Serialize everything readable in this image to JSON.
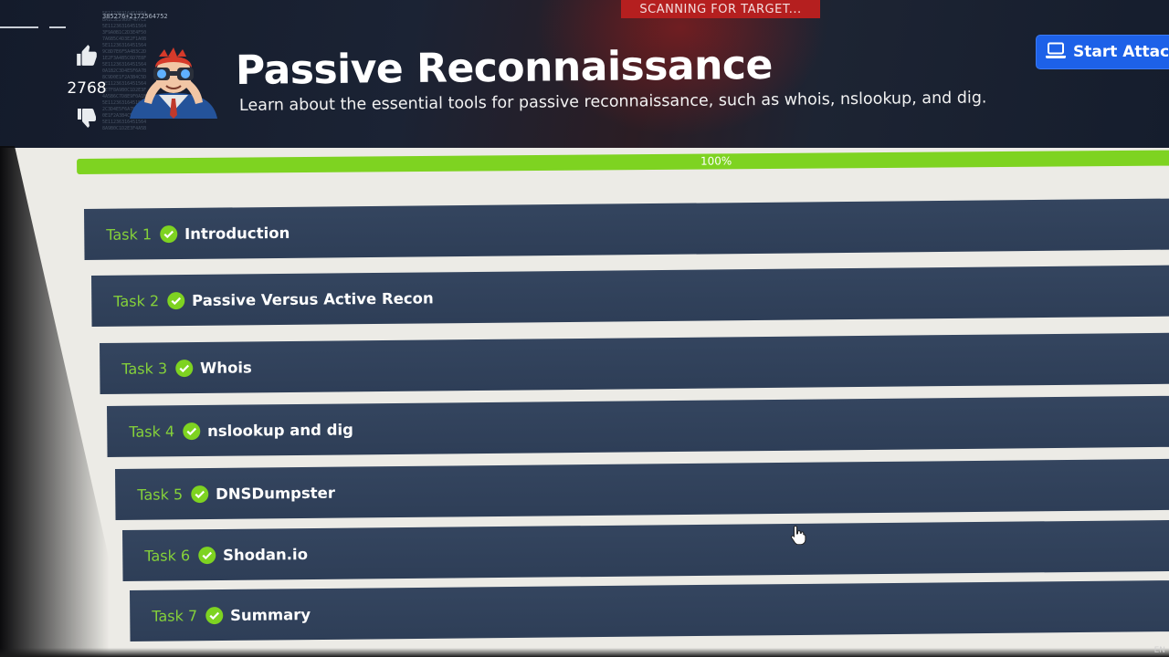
{
  "header": {
    "scanning_text": "SCANNING FOR TARGET...",
    "hex_text": "385276+2172564752",
    "votes": "2768",
    "title": "Passive Reconnaissance",
    "subtitle": "Learn about the essential tools for passive reconnaissance, such as whois, nslookup, and dig.",
    "attack_button": "Start AttackBox",
    "colors": {
      "banner": "#1b2334",
      "attack_button": "#1d61e8"
    },
    "icons": [
      "thumbs-up-icon",
      "thumbs-down-icon",
      "laptop-icon"
    ]
  },
  "progress": {
    "label": "100%",
    "value": 1.0,
    "color": "#7ed321"
  },
  "tasks": [
    {
      "number": "Task 1",
      "name": "Introduction"
    },
    {
      "number": "Task 2",
      "name": "Passive Versus Active Recon"
    },
    {
      "number": "Task 3",
      "name": "Whois"
    },
    {
      "number": "Task 4",
      "name": "nslookup and dig"
    },
    {
      "number": "Task 5",
      "name": "DNSDumpster"
    },
    {
      "number": "Task 6",
      "name": "Shodan.io"
    },
    {
      "number": "Task 7",
      "name": "Summary"
    }
  ],
  "task_colors": {
    "bar": "#34455f",
    "number": "#85d13a",
    "check": "#7ed321"
  },
  "system": {
    "keyboard_layout": "EN"
  }
}
